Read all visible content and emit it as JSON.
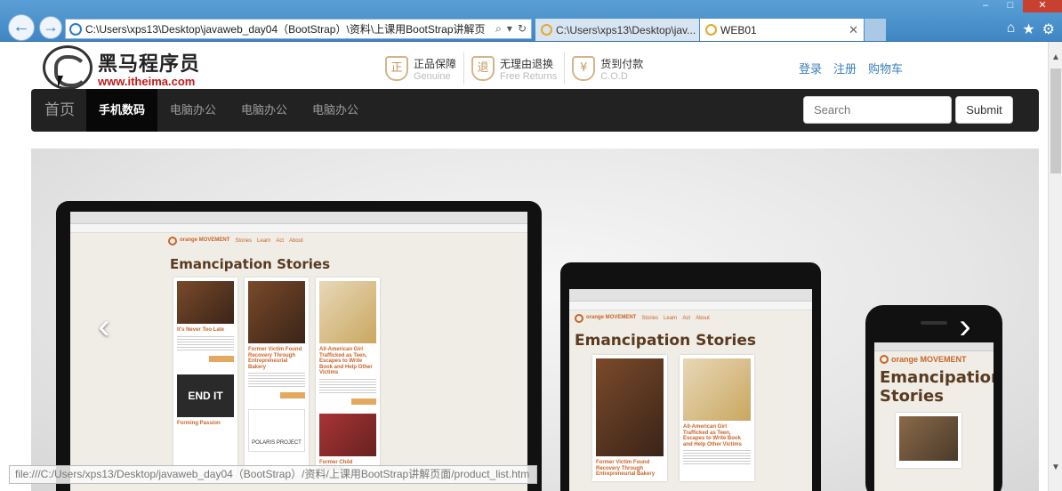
{
  "browser": {
    "address": "C:\\Users\\xps13\\Desktop\\javaweb_day04（BootStrap）\\资料\\上课用BootStrap讲解页",
    "tabs": [
      {
        "title": "C:\\Users\\xps13\\Desktop\\jav..."
      },
      {
        "title": "WEB01",
        "close": "✕"
      }
    ],
    "window_controls": [
      "–",
      "□",
      "✕"
    ],
    "icons": [
      "home-icon",
      "favorites-icon",
      "settings-icon"
    ],
    "status_url": "file:///C:/Users/xps13/Desktop/javaweb_day04（BootStrap）/资料/上课用BootStrap讲解页面/product_list.htm"
  },
  "header": {
    "logo_cn": "黑马程序员",
    "logo_url": "www.itheima.com",
    "badges": [
      {
        "icon": "正",
        "title": "正品保障",
        "sub": "Genuine"
      },
      {
        "icon": "退",
        "title": "无理由退换",
        "sub": "Free Returns"
      },
      {
        "icon": "¥",
        "title": "货到付款",
        "sub": "C.O.D"
      }
    ],
    "user_links": [
      "登录",
      "注册",
      "购物车"
    ]
  },
  "navbar": {
    "brand": "首页",
    "items": [
      {
        "label": "手机数码",
        "active": true
      },
      {
        "label": "电脑办公",
        "active": false
      },
      {
        "label": "电脑办公",
        "active": false
      },
      {
        "label": "电脑办公",
        "active": false
      }
    ],
    "search_placeholder": "Search",
    "submit_label": "Submit"
  },
  "carousel": {
    "prev": "‹",
    "next": "›",
    "slide": {
      "site_name": "orange MOVEMENT",
      "nav": [
        "Stories",
        "Learn",
        "Act",
        "About"
      ],
      "heading": "Emancipation Stories",
      "phone_heading": "Emancipation Stories",
      "cards": [
        {
          "caption": "It's Never Too Late"
        },
        {
          "caption": "Former Victim Found Recovery Through Entrepreneurial Bakery"
        },
        {
          "caption": "All-American Girl Trafficked as Teen, Escapes to Write Book and Help Other Victims"
        },
        {
          "caption": "Forming Passion"
        },
        {
          "caption": "POLARIS PROJECT"
        },
        {
          "caption": "Former Child Prostitute"
        }
      ],
      "endit": "END IT"
    }
  },
  "colors": {
    "navbar_bg": "#222222",
    "link": "#3a7fb8",
    "logo_red": "#c21b1b",
    "ie_chrome": "#3f86c4"
  }
}
